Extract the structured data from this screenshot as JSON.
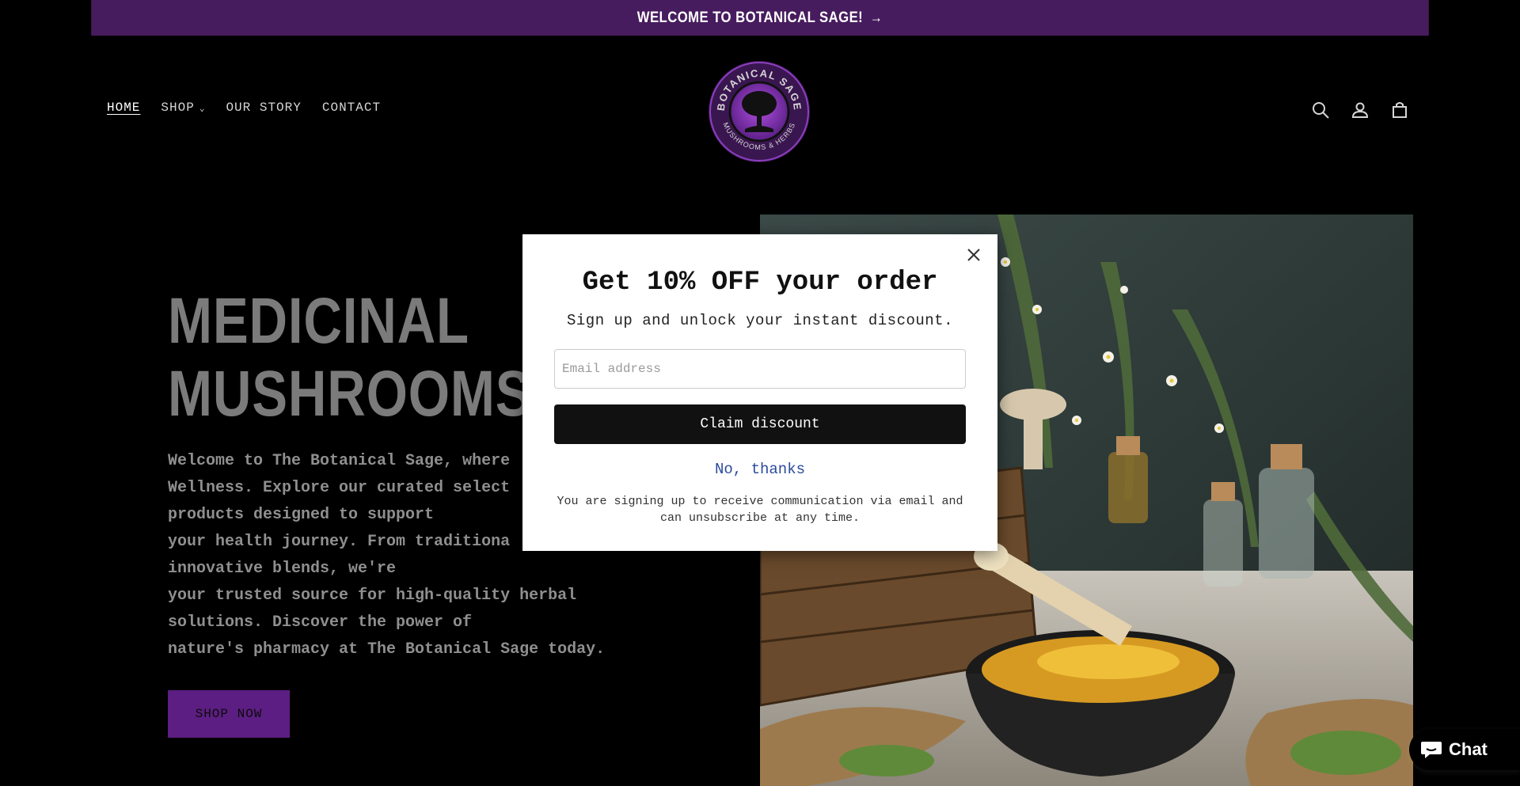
{
  "announcement": {
    "text": "WELCOME TO BOTANICAL SAGE!",
    "arrow": "→"
  },
  "nav": {
    "items": [
      {
        "label": "HOME"
      },
      {
        "label": "SHOP"
      },
      {
        "label": "OUR STORY"
      },
      {
        "label": "CONTACT"
      }
    ]
  },
  "logo": {
    "top_text": "BOTANICAL SAGE",
    "bottom_text": "MUSHROOMS & HERBS"
  },
  "header_icons": [
    "search-icon",
    "account-icon",
    "cart-icon"
  ],
  "hero": {
    "title": "MEDICINAL\nMUSHROOMS &",
    "body": "Welcome to The Botanical Sage, where\nWellness. Explore our curated select\nproducts designed to support\nyour health journey. From traditiona\ninnovative blends, we're\nyour trusted source for high-quality herbal\nsolutions. Discover the power of\nnature's pharmacy at The Botanical Sage today.",
    "cta": "SHOP NOW"
  },
  "popup": {
    "title": "Get 10% OFF your order",
    "subtitle": "Sign up and unlock your instant discount.",
    "email_placeholder": "Email address",
    "claim_label": "Claim discount",
    "decline_label": "No, thanks",
    "legal": "You are signing up to receive communication via email and can unsubscribe at any time."
  },
  "chat": {
    "label": "Chat"
  },
  "colors": {
    "announcement_bg": "#471c5e",
    "cta_bg": "#5c1e82",
    "background": "#000000",
    "popup_link": "#2b4a9b"
  }
}
